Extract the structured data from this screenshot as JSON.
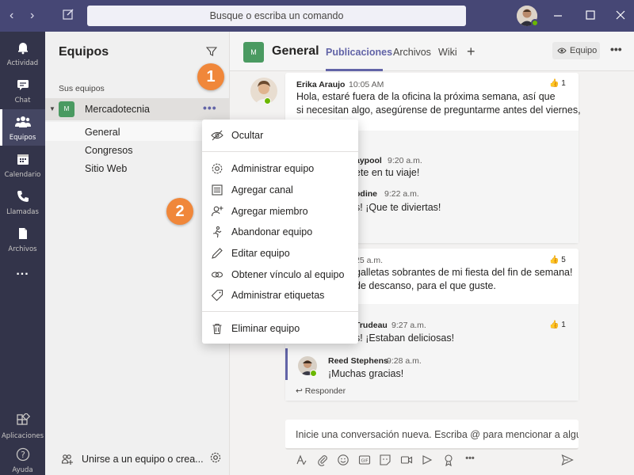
{
  "titlebar": {
    "search_placeholder": "Busque o escriba un comando"
  },
  "rail": {
    "items": [
      {
        "label": "Actividad",
        "icon": "bell-icon"
      },
      {
        "label": "Chat",
        "icon": "chat-icon"
      },
      {
        "label": "Equipos",
        "icon": "teams-icon",
        "active": true
      },
      {
        "label": "Calendario",
        "icon": "calendar-icon"
      },
      {
        "label": "Llamadas",
        "icon": "phone-icon"
      },
      {
        "label": "Archivos",
        "icon": "file-icon"
      },
      {
        "label": "...",
        "icon": "more-icon"
      }
    ],
    "apps_label": "Aplicaciones",
    "help_label": "Ayuda"
  },
  "teams_panel": {
    "title": "Equipos",
    "section_label": "Sus equipos",
    "team": {
      "name": "Mercadotecnia",
      "badge": "M",
      "more": "•••"
    },
    "channels": [
      "General",
      "Congresos",
      "Sitio Web"
    ],
    "join_text": "Unirse a un equipo o crea..."
  },
  "channel_header": {
    "badge": "M",
    "title": "General",
    "tabs": [
      "Publicaciones",
      "Archivos",
      "Wiki"
    ],
    "add_tab": "+",
    "team_button": "Equipo",
    "more": "•••"
  },
  "messages": {
    "post1": {
      "author": "Erika Araujo",
      "time": "10:05 AM",
      "text_line1": "Hola, estaré fuera de la oficina la próxima semana, así que",
      "text_line2": "si necesitan algo, asegúrense de preguntarme antes del viernes,",
      "likes": "1",
      "reply1_author": "aypool",
      "reply1_time": "9:20 a.m.",
      "reply1_text": "ete en tu viaje!",
      "reply2_author": "odine",
      "reply2_time": "9:22 a.m.",
      "reply2_text": "s! ¡Que te diviertas!"
    },
    "post2": {
      "time": "25 a.m.",
      "text_line1": "galletas sobrantes de mi fiesta del fin de semana!",
      "text_line2": "de descanso, para el que guste.",
      "likes": "5",
      "reply1_author": "Trudeau",
      "reply1_time": "9:27 a.m.",
      "reply1_text": "s! ¡Estaban deliciosas!",
      "reply1_likes": "1",
      "reply2_author": "Reed Stephens",
      "reply2_time": "9:28 a.m.",
      "reply2_text": "¡Muchas gracias!",
      "reply_link": "Responder"
    }
  },
  "compose": {
    "placeholder": "Inicie una conversación nueva. Escriba @ para mencionar a alguien."
  },
  "menu": {
    "items": [
      {
        "label": "Ocultar",
        "icon": "hide-icon"
      },
      {
        "label": "Administrar equipo",
        "icon": "gear-icon"
      },
      {
        "label": "Agregar canal",
        "icon": "add-channel-icon"
      },
      {
        "label": "Agregar miembro",
        "icon": "add-member-icon"
      },
      {
        "label": "Abandonar equipo",
        "icon": "leave-icon"
      },
      {
        "label": "Editar equipo",
        "icon": "pencil-icon"
      },
      {
        "label": "Obtener vínculo al equipo",
        "icon": "link-icon"
      },
      {
        "label": "Administrar etiquetas",
        "icon": "tag-icon"
      },
      {
        "label": "Eliminar equipo",
        "icon": "trash-icon"
      }
    ]
  },
  "callouts": [
    "1",
    "2"
  ],
  "colors": {
    "titlebar": "#464775",
    "rail": "#33344a",
    "accent": "#6264a7",
    "team_badge": "#4a9a61",
    "callout": "#f0873a",
    "presence": "#6bb700"
  }
}
